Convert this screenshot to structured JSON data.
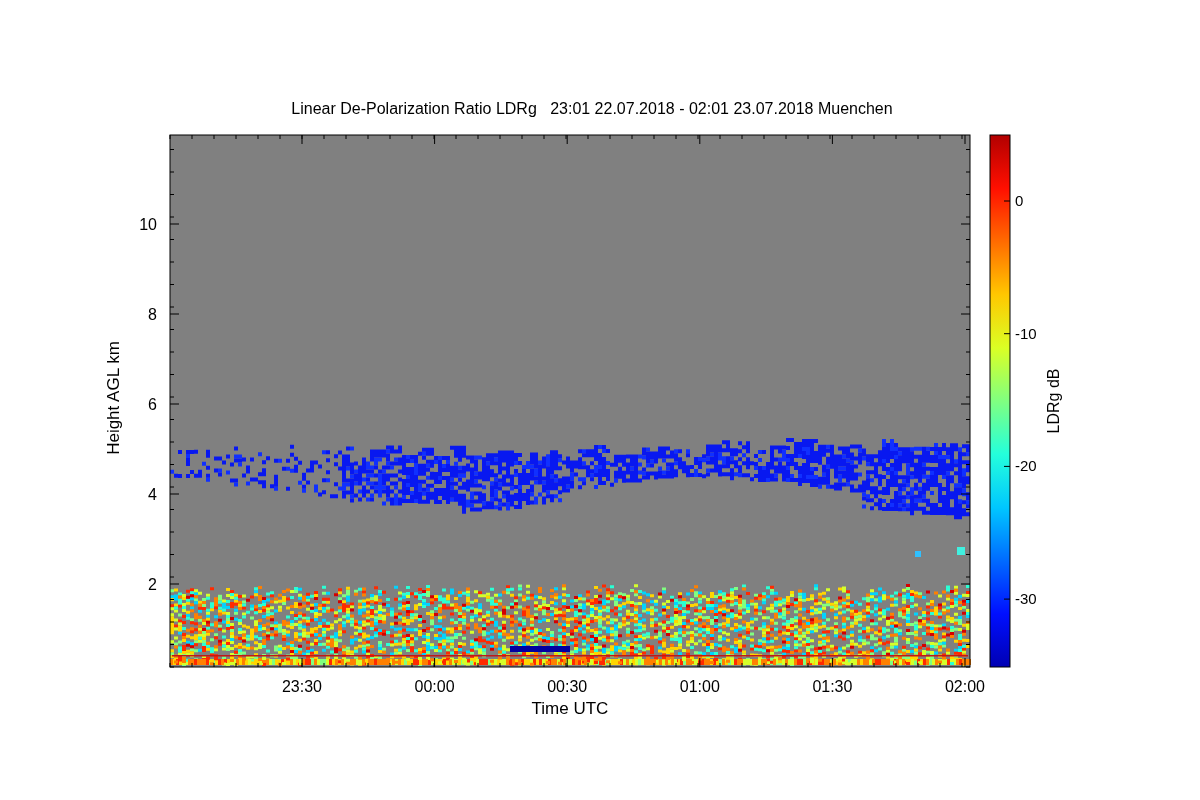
{
  "title": "Linear De-Polarization Ratio LDRg   23:01 22.07.2018 - 02:01 23.07.2018 Muenchen",
  "plot": {
    "xlabel": "Time UTC",
    "ylabel": "Height AGL km",
    "xticks": [
      "23:30",
      "00:00",
      "00:30",
      "01:00",
      "01:30",
      "02:00"
    ],
    "yticks": [
      "10",
      "8",
      "6",
      "4",
      "2"
    ]
  },
  "colorbar": {
    "label": "LDRg dB",
    "ticks": [
      "0",
      "-10",
      "-20",
      "-30"
    ]
  }
}
